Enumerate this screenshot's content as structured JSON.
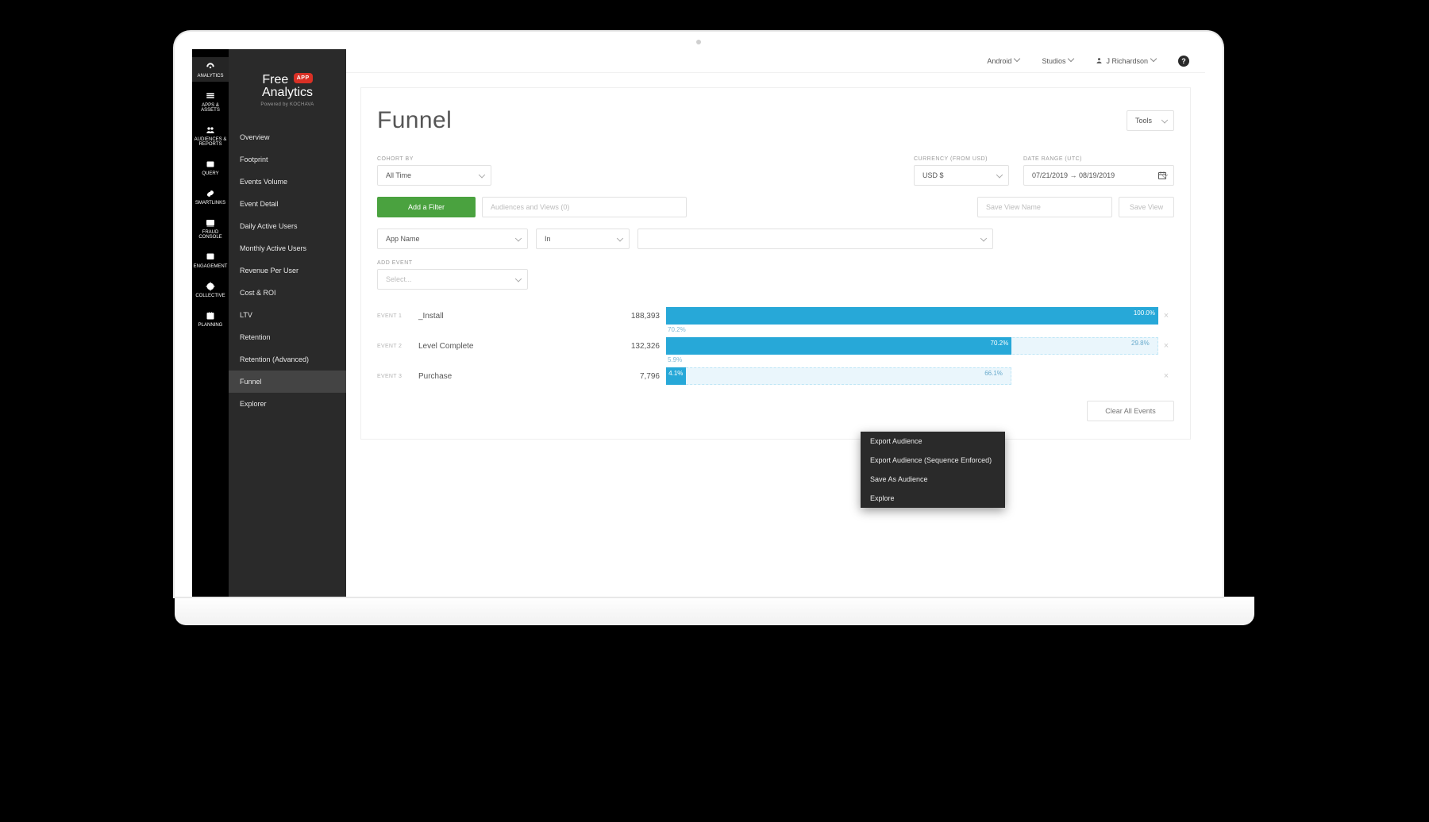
{
  "rail": [
    {
      "name": "analytics",
      "label": "ANALYTICS"
    },
    {
      "name": "apps-assets",
      "label": "APPS & ASSETS"
    },
    {
      "name": "audiences-reports",
      "label": "AUDIENCES & REPORTS"
    },
    {
      "name": "query",
      "label": "QUERY"
    },
    {
      "name": "smartlinks",
      "label": "SMARTLINKS"
    },
    {
      "name": "fraud-console",
      "label": "FRAUD CONSOLE"
    },
    {
      "name": "engagement",
      "label": "ENGAGEMENT"
    },
    {
      "name": "collective",
      "label": "COLLECTIVE"
    },
    {
      "name": "planning",
      "label": "PLANNING"
    }
  ],
  "brand": {
    "word1": "Free",
    "badge": "APP",
    "word2": "Analytics",
    "powered": "Powered by KOCHAVA"
  },
  "nav": {
    "items": [
      "Overview",
      "Footprint",
      "Events Volume",
      "Event Detail",
      "Daily Active Users",
      "Monthly Active Users",
      "Revenue Per User",
      "Cost & ROI",
      "LTV",
      "Retention",
      "Retention (Advanced)",
      "Funnel",
      "Explorer"
    ],
    "active": "Funnel"
  },
  "topbar": {
    "platform": "Android",
    "workspace": "Studios",
    "user": "J Richardson"
  },
  "page": {
    "title": "Funnel",
    "tools": "Tools"
  },
  "filters": {
    "cohort_label": "COHORT BY",
    "cohort_value": "All Time",
    "currency_label": "CURRENCY (FROM USD)",
    "currency_value": "USD $",
    "date_label": "DATE RANGE (UTC)",
    "date_value": "07/21/2019 → 08/19/2019",
    "add_filter": "Add a Filter",
    "audiences_placeholder": "Audiences and Views (0)",
    "save_view_placeholder": "Save View Name",
    "save_view_btn": "Save View",
    "dim_value": "App Name",
    "op_value": "In",
    "add_event_label": "ADD EVENT",
    "add_event_placeholder": "Select..."
  },
  "chart_data": {
    "type": "bar",
    "events": [
      {
        "idx": "EVENT 1",
        "name": "_Install",
        "count": "188,393",
        "pct": 100.0,
        "drop_next": 70.2,
        "remaining_from_prev": null
      },
      {
        "idx": "EVENT 2",
        "name": "Level Complete",
        "count": "132,326",
        "pct": 70.2,
        "drop_next": 5.9,
        "remaining_from_prev": 29.8
      },
      {
        "idx": "EVENT 3",
        "name": "Purchase",
        "count": "7,796",
        "pct": 4.1,
        "drop_next": null,
        "remaining_from_prev": 66.1
      }
    ]
  },
  "context_menu": [
    "Export Audience",
    "Export Audience (Sequence Enforced)",
    "Save As Audience",
    "Explore"
  ],
  "clear_events": "Clear All Events"
}
